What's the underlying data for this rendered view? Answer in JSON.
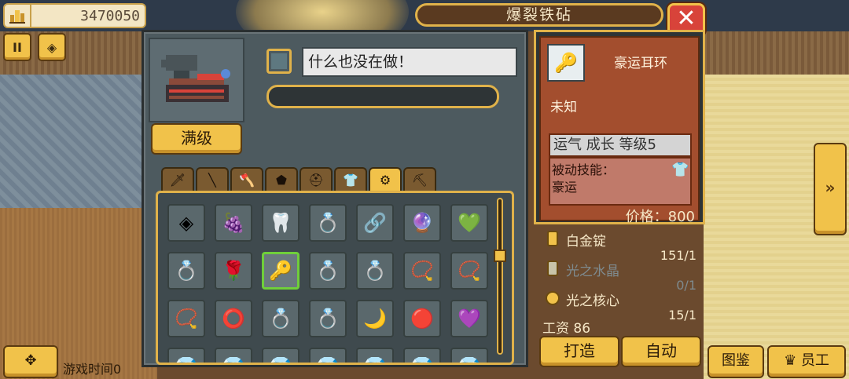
{
  "topbar": {
    "money_value": "3470050",
    "title": "爆裂铁砧",
    "close_label": "✕",
    "left_buttons": [
      "II",
      "◈"
    ]
  },
  "crafting": {
    "max_level_label": "满级",
    "status_text": "什么也没在做！",
    "progress_percent": 0
  },
  "category_tabs": [
    "🗡",
    "╲",
    "🪓",
    "⬟",
    "⛑",
    "👕",
    "⚙",
    "⛏"
  ],
  "active_tab_index": 6,
  "items": [
    "◈",
    "🍇",
    "🦷",
    "💍",
    "🔗",
    "🔮",
    "💚",
    "💍",
    "🌹",
    "🔑",
    "💍",
    "💍",
    "📿",
    "📿",
    "📿",
    "⭕",
    "💍",
    "💍",
    "🌙",
    "🔴",
    "💜",
    "💎",
    "💎",
    "💎",
    "💎",
    "💎",
    "💎",
    "💎"
  ],
  "selected_item_index": 9,
  "detail": {
    "item_name": "豪运耳环",
    "rarity": "未知",
    "stats": "运气 成长 等级5",
    "skill_label": "被动技能：",
    "skill_value": "豪运",
    "price": "价格：800"
  },
  "materials": [
    {
      "name": "白金锭",
      "qty": "151/1",
      "available": true
    },
    {
      "name": "光之水晶",
      "qty": "0/1",
      "available": false
    },
    {
      "name": "光之核心",
      "qty": "15/1",
      "available": true
    }
  ],
  "wage": "工资 86",
  "actions": {
    "craft_label": "打造",
    "auto_label": "自动"
  },
  "bottom": {
    "side_arrow": "»",
    "catalog_label": "图鉴",
    "staff_label": "员工",
    "game_time": "游戏时间0"
  }
}
